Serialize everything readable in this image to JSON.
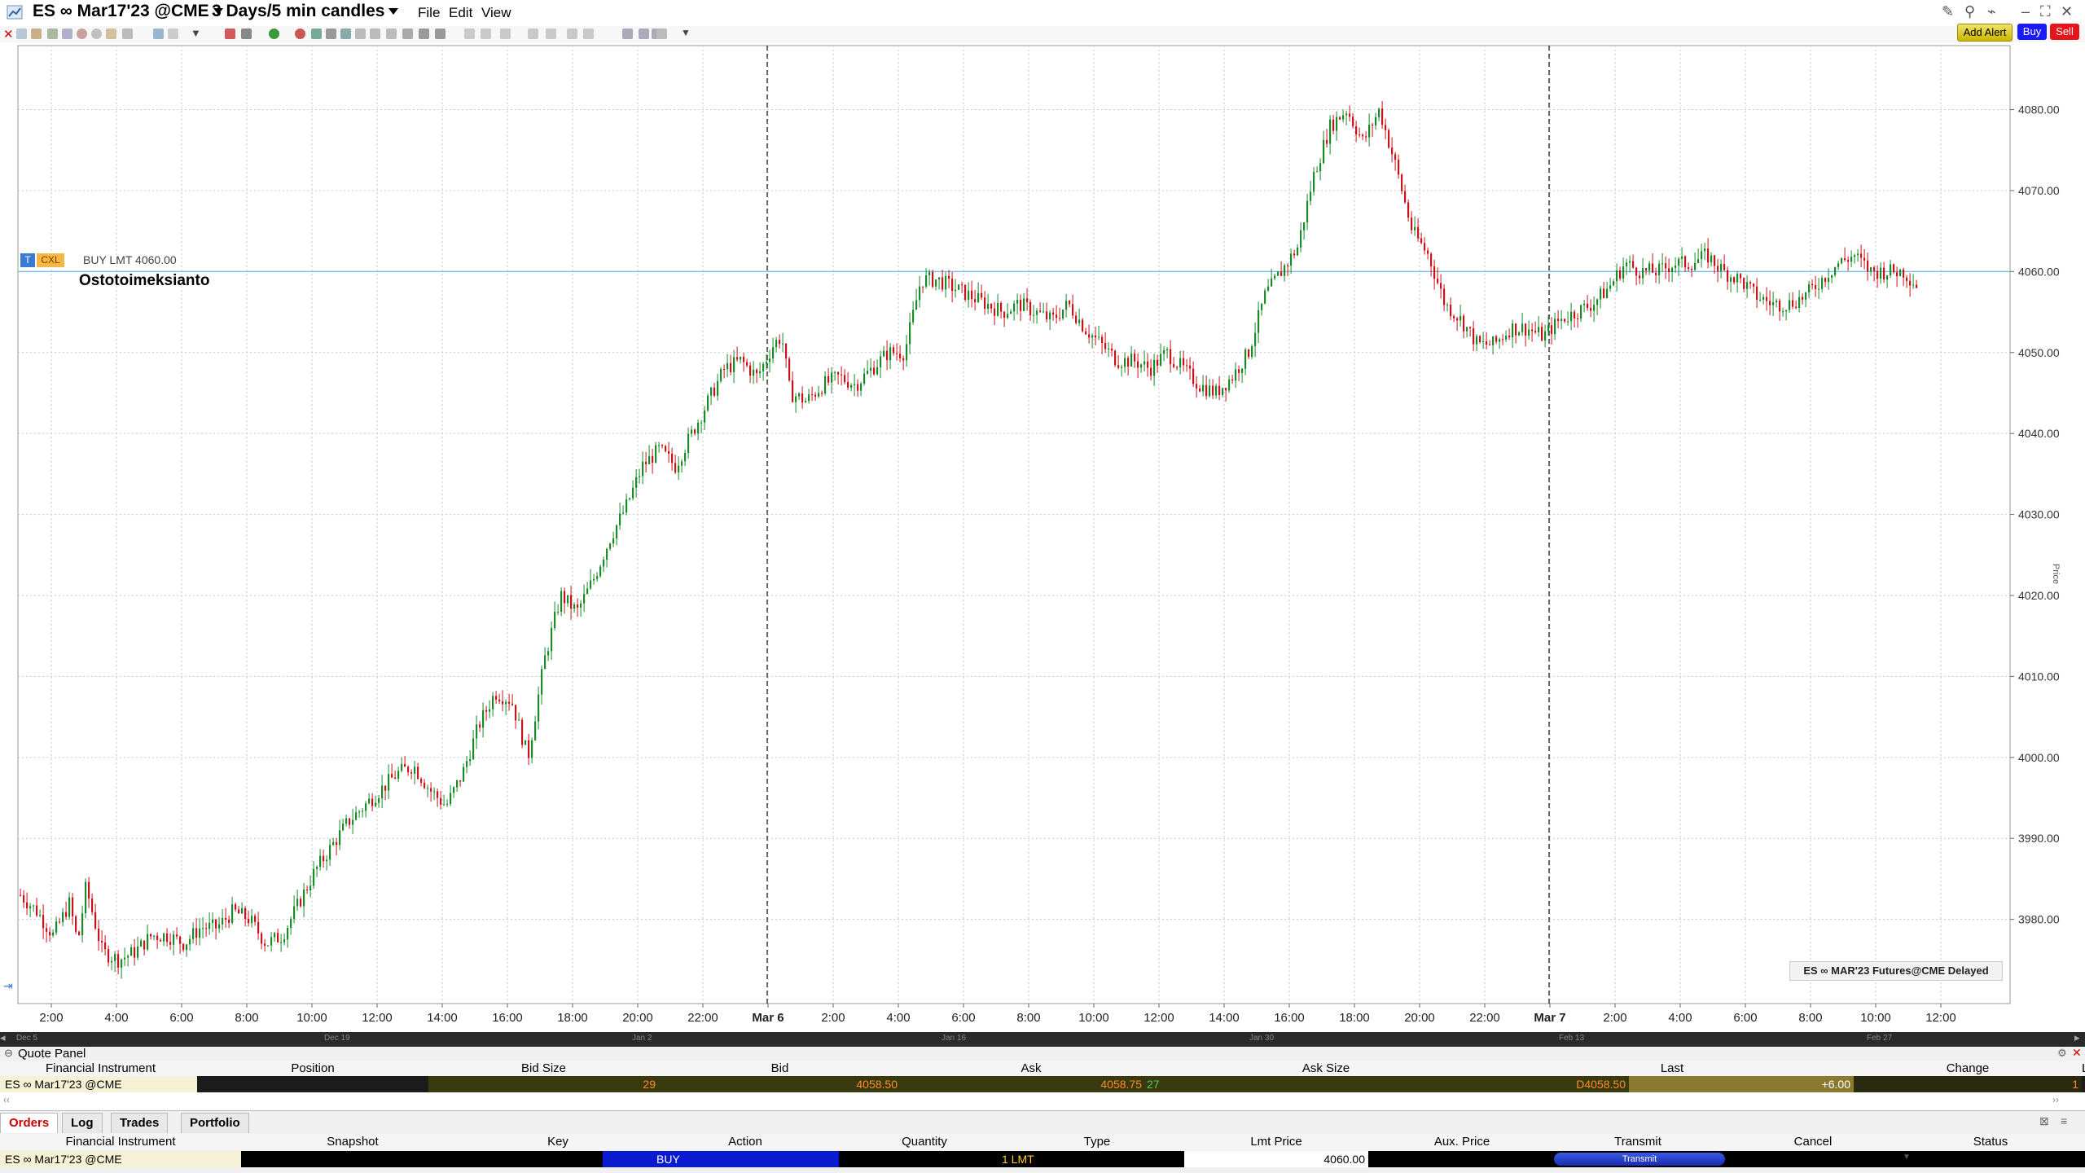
{
  "window": {
    "symbol": "ES ∞ Mar17'23 @CME",
    "period": "3 Days/5 min candles",
    "menu": [
      "File",
      "Edit",
      "View"
    ],
    "order_buttons": {
      "add_alert": "Add Alert",
      "buy": "Buy",
      "sell": "Sell"
    },
    "colors": {
      "buy": "#1a1aff",
      "sell": "#e8131b",
      "alert": "#d6c400",
      "up_candle": "#1a8a2a",
      "down_candle": "#c4141c",
      "order_line": "#7fbfe6"
    }
  },
  "chart": {
    "order_tag": {
      "t": "T",
      "cxl": "CXL",
      "label": "BUY LMT 4060.00"
    },
    "annotation": "Ostotoimeksianto",
    "watermark": "ES ∞ MAR'23 Futures@CME Delayed",
    "price_axis_title": "Price",
    "nav_labels": [
      "Dec 5",
      "Dec 19",
      "Jan 2",
      "Jan 16",
      "Jan 30",
      "Feb 13",
      "Feb 27"
    ]
  },
  "chart_data": {
    "type": "candlestick",
    "y_ticks": [
      3980,
      3990,
      4000,
      4010,
      4020,
      4030,
      4040,
      4050,
      4060,
      4070,
      4080
    ],
    "y_tick_labels": [
      "3980.00",
      "3990.00",
      "4000.00",
      "4010.00",
      "4020.00",
      "4030.00",
      "4040.00",
      "4050.00",
      "4060.00",
      "4070.00",
      "4080.00"
    ],
    "ylim": [
      3969.6,
      4087.9
    ],
    "x_ticks": [
      "2:00",
      "4:00",
      "6:00",
      "8:00",
      "10:00",
      "12:00",
      "14:00",
      "16:00",
      "18:00",
      "20:00",
      "22:00",
      "Mar 6",
      "2:00",
      "4:00",
      "6:00",
      "8:00",
      "10:00",
      "12:00",
      "14:00",
      "16:00",
      "18:00",
      "20:00",
      "22:00",
      "Mar 7",
      "2:00",
      "4:00",
      "6:00",
      "8:00",
      "10:00",
      "12:00"
    ],
    "session_breaks": [
      "Mar 6",
      "Mar 7"
    ],
    "order_line_price": 4060.0,
    "price_path": [
      [
        0,
        3983
      ],
      [
        2,
        3981
      ],
      [
        4,
        3978
      ],
      [
        6,
        3982
      ],
      [
        7,
        3977
      ],
      [
        8,
        3984
      ],
      [
        10,
        3976
      ],
      [
        12,
        3975
      ],
      [
        14,
        3976
      ],
      [
        16,
        3978
      ],
      [
        18,
        3978
      ],
      [
        20,
        3977
      ],
      [
        22,
        3979
      ],
      [
        24,
        3979
      ],
      [
        26,
        3981
      ],
      [
        28,
        3980
      ],
      [
        30,
        3977
      ],
      [
        32,
        3978
      ],
      [
        34,
        3982
      ],
      [
        36,
        3986
      ],
      [
        38,
        3989
      ],
      [
        40,
        3992
      ],
      [
        42,
        3994
      ],
      [
        44,
        3996
      ],
      [
        46,
        3998
      ],
      [
        48,
        3999
      ],
      [
        50,
        3996
      ],
      [
        52,
        3994
      ],
      [
        54,
        3998
      ],
      [
        56,
        4004
      ],
      [
        58,
        4008
      ],
      [
        60,
        4007
      ],
      [
        62,
        4000
      ],
      [
        64,
        4012
      ],
      [
        66,
        4020
      ],
      [
        68,
        4018
      ],
      [
        70,
        4022
      ],
      [
        72,
        4027
      ],
      [
        74,
        4031
      ],
      [
        76,
        4036
      ],
      [
        78,
        4038
      ],
      [
        80,
        4036
      ],
      [
        82,
        4040
      ],
      [
        84,
        4044
      ],
      [
        86,
        4048
      ],
      [
        88,
        4049
      ],
      [
        90,
        4047
      ],
      [
        92,
        4051
      ],
      [
        93,
        4052
      ],
      [
        94,
        4045
      ],
      [
        96,
        4044
      ],
      [
        98,
        4046
      ],
      [
        100,
        4047
      ],
      [
        102,
        4046
      ],
      [
        104,
        4048
      ],
      [
        106,
        4050
      ],
      [
        108,
        4050
      ],
      [
        110,
        4059
      ],
      [
        112,
        4059
      ],
      [
        114,
        4058
      ],
      [
        116,
        4057
      ],
      [
        118,
        4056
      ],
      [
        120,
        4055
      ],
      [
        122,
        4056
      ],
      [
        124,
        4055
      ],
      [
        126,
        4054
      ],
      [
        128,
        4056
      ],
      [
        130,
        4053
      ],
      [
        132,
        4051
      ],
      [
        134,
        4049
      ],
      [
        136,
        4049
      ],
      [
        138,
        4048
      ],
      [
        140,
        4050
      ],
      [
        142,
        4048
      ],
      [
        144,
        4046
      ],
      [
        146,
        4045
      ],
      [
        148,
        4047
      ],
      [
        150,
        4050
      ],
      [
        152,
        4057
      ],
      [
        154,
        4060
      ],
      [
        156,
        4063
      ],
      [
        158,
        4072
      ],
      [
        160,
        4078
      ],
      [
        162,
        4080
      ],
      [
        164,
        4076
      ],
      [
        166,
        4080
      ],
      [
        168,
        4073
      ],
      [
        170,
        4065
      ],
      [
        172,
        4062
      ],
      [
        174,
        4056
      ],
      [
        176,
        4054
      ],
      [
        178,
        4051
      ],
      [
        180,
        4051
      ],
      [
        182,
        4053
      ],
      [
        184,
        4053
      ],
      [
        186,
        4052
      ],
      [
        188,
        4054
      ],
      [
        190,
        4055
      ],
      [
        192,
        4056
      ],
      [
        194,
        4058
      ],
      [
        196,
        4061
      ],
      [
        198,
        4060
      ],
      [
        200,
        4060
      ],
      [
        202,
        4061
      ],
      [
        204,
        4061
      ],
      [
        206,
        4062
      ],
      [
        208,
        4060
      ],
      [
        210,
        4059
      ],
      [
        212,
        4057
      ],
      [
        214,
        4056
      ],
      [
        216,
        4056
      ],
      [
        218,
        4057
      ],
      [
        220,
        4059
      ],
      [
        222,
        4061
      ],
      [
        224,
        4062
      ],
      [
        226,
        4060
      ],
      [
        228,
        4060
      ],
      [
        230,
        4060
      ],
      [
        232,
        4058
      ]
    ]
  },
  "quote_panel": {
    "title": "Quote Panel",
    "headers": [
      "Financial Instrument",
      "Position",
      "Bid Size",
      "Bid",
      "Ask",
      "Ask Size",
      "Last",
      "Change",
      "Last Size"
    ],
    "row": {
      "instrument": "ES ∞ Mar17'23 @CME",
      "position": "",
      "bid_size": "29",
      "bid": "4058.50",
      "ask": "4058.75",
      "ask_size": "27",
      "last": "D4058.50",
      "change": "+6.00",
      "last_size": "1"
    }
  },
  "orders_panel": {
    "tabs": [
      "Orders",
      "Log",
      "Trades",
      "Portfolio"
    ],
    "headers": [
      "Financial Instrument",
      "Snapshot",
      "Key",
      "Action",
      "Quantity",
      "Type",
      "Lmt Price",
      "Aux. Price",
      "Transmit",
      "Cancel",
      "Status"
    ],
    "row": {
      "instrument": "ES ∞ Mar17'23 @CME",
      "action": "BUY",
      "quantity_type": "1 LMT",
      "lmt_price": "4060.00",
      "transmit": "Transmit"
    }
  }
}
